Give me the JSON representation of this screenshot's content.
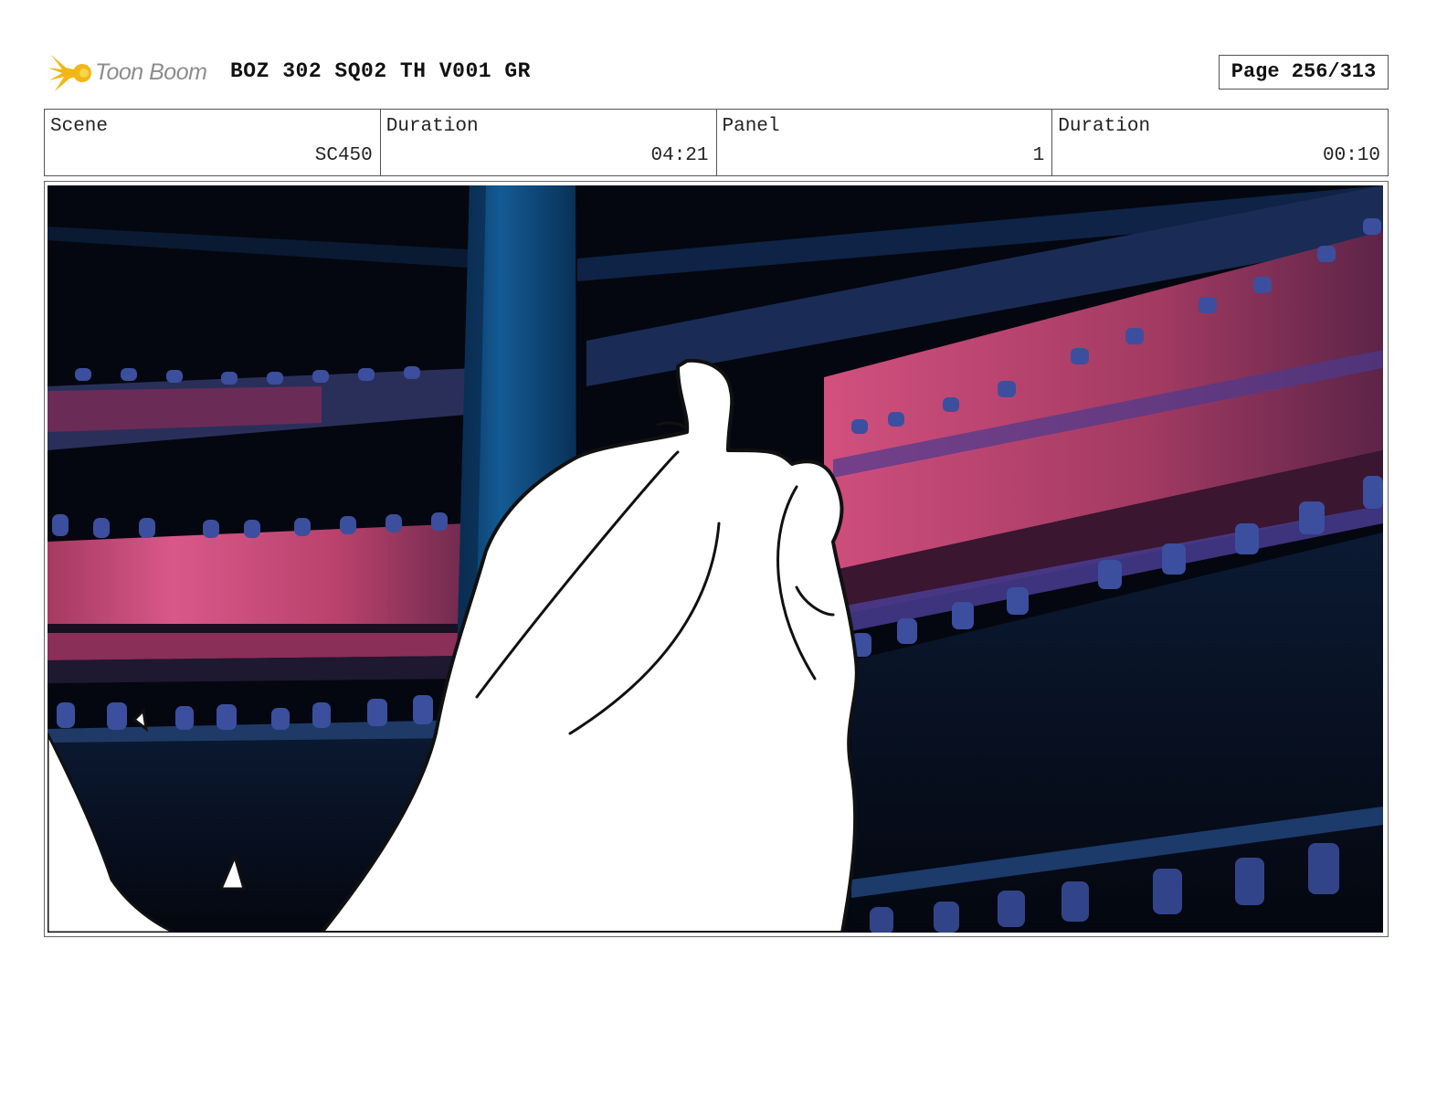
{
  "header": {
    "logo_text": "Toon Boom",
    "title": "BOZ 302 SQ02 TH V001 GR",
    "page_label": "Page 256/313"
  },
  "info": {
    "scene_label": "Scene",
    "scene_value": "SC450",
    "scene_duration_label": "Duration",
    "scene_duration_value": "04:21",
    "panel_label": "Panel",
    "panel_value": "1",
    "panel_duration_label": "Duration",
    "panel_duration_value": "00:10"
  },
  "colors": {
    "logo_star": "#f2b617",
    "balcony_pink": "#c4456e",
    "balcony_blue": "#1d4a7c",
    "background_dark": "#050a16",
    "pillar_blue": "#0f4f82"
  }
}
